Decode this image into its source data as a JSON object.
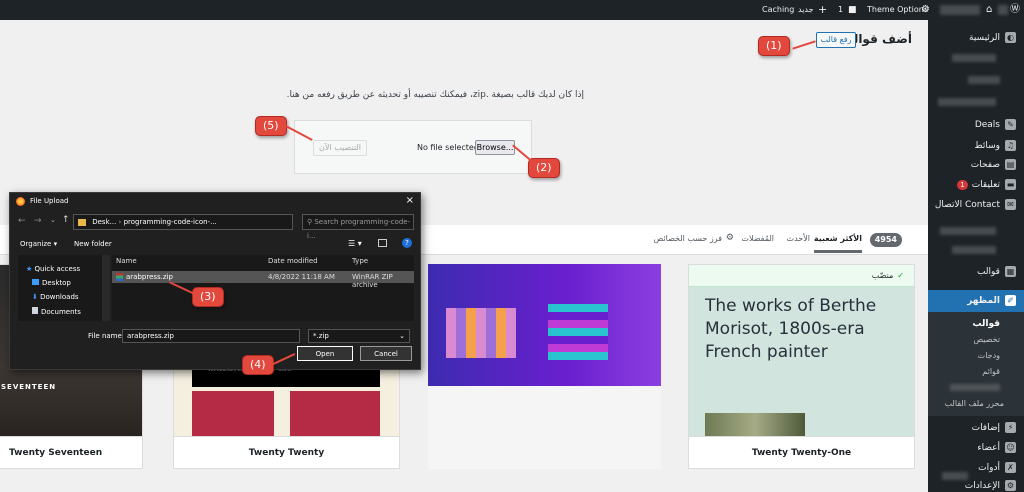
{
  "admin_bar": {
    "theme_options": "Theme Options",
    "comments_count": "1",
    "new_label": "جديد",
    "caching": "Caching"
  },
  "sidebar": {
    "home": "الرئيسية",
    "deals": "Deals",
    "media": "وسائط",
    "pages": "صفحات",
    "comments": "تعليقات",
    "comments_badge": "1",
    "contact": "Contact الاتصال",
    "templates": "قوالب",
    "appearance": "المظهر",
    "sub_themes": "قوالب",
    "sub_customize": "تخصيص",
    "sub_widgets": "ودجات",
    "sub_menus": "قوائم",
    "sub_theme_editor": "محرر ملف القالب",
    "plugins": "إضافات",
    "users": "أعضاء",
    "tools": "أدوات",
    "settings": "الإعدادات"
  },
  "header": {
    "page_title": "أضف قوالب",
    "upload_button": "رفع قالب"
  },
  "upload": {
    "description": "إذا كان لديك قالب بصيغة .zip، فيمكنك تنصيبه أو تحديثه عن طريق رفعه من هنا.",
    "browse_button": "Browse...",
    "no_file": "No file selected.",
    "install_button": "التنصيب الآن"
  },
  "filters": {
    "count": "4954",
    "popular": "الأكثر شعبية",
    "latest": "الأحدث",
    "favorites": "المُفضلات",
    "feature_filter": "فرز حسب الخصائص"
  },
  "themes": [
    {
      "name": "Twenty Seventeen",
      "label": "SEVENTEEN"
    },
    {
      "name": "Twenty Twenty",
      "label": "113 Swanson, US · 0000 — 10.00 · 100 kr"
    },
    {
      "name": "",
      "label": ""
    },
    {
      "name": "Twenty Twenty-One",
      "installed": "منصّب",
      "headline": "The works of Berthe Morisot, 1800s-era French painter"
    }
  ],
  "dialog": {
    "title": "File Upload",
    "path_root": "Desk...",
    "path_folder": "programming-code-icon-...",
    "search_placeholder": "Search programming-code-i...",
    "organize": "Organize",
    "new_folder": "New folder",
    "nav": [
      "Quick access",
      "Desktop",
      "Downloads",
      "Documents"
    ],
    "columns": [
      "Name",
      "Date modified",
      "Type"
    ],
    "file": {
      "name": "arabpress.zip",
      "date": "4/8/2022 11:18 AM",
      "type": "WinRAR ZIP archive"
    },
    "file_name_label": "File name:",
    "file_name_value": "arabpress.zip",
    "filter_value": "*.zip",
    "open_button": "Open",
    "cancel_button": "Cancel"
  },
  "callouts": [
    "(1)",
    "(2)",
    "(3)",
    "(4)",
    "(5)"
  ],
  "colors": {
    "accent": "#2271b1",
    "callout": "#e3483d",
    "admin_bar": "#1d2327",
    "active_menu": "#2271b1"
  }
}
